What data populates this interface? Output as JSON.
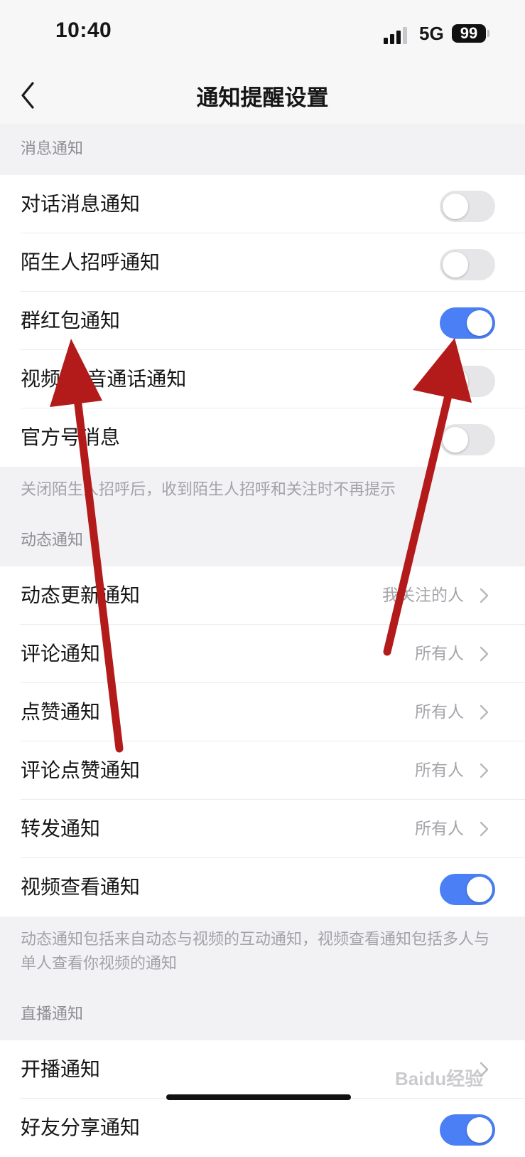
{
  "status_bar": {
    "time": "10:40",
    "network": "5G",
    "battery": "99"
  },
  "header": {
    "title": "通知提醒设置"
  },
  "sections": [
    {
      "header": "消息通知",
      "items": [
        {
          "label": "对话消息通知",
          "control": "toggle",
          "on": false
        },
        {
          "label": "陌生人招呼通知",
          "control": "toggle",
          "on": false
        },
        {
          "label": "群红包通知",
          "control": "toggle",
          "on": true
        },
        {
          "label": "视频/语音通话通知",
          "control": "toggle",
          "on": false
        },
        {
          "label": "官方号消息",
          "control": "toggle",
          "on": false
        }
      ],
      "footnote": "关闭陌生人招呼后，收到陌生人招呼和关注时不再提示"
    },
    {
      "header": "动态通知",
      "items": [
        {
          "label": "动态更新通知",
          "control": "value",
          "value": "我关注的人"
        },
        {
          "label": "评论通知",
          "control": "value",
          "value": "所有人"
        },
        {
          "label": "点赞通知",
          "control": "value",
          "value": "所有人"
        },
        {
          "label": "评论点赞通知",
          "control": "value",
          "value": "所有人"
        },
        {
          "label": "转发通知",
          "control": "value",
          "value": "所有人"
        },
        {
          "label": "视频查看通知",
          "control": "toggle",
          "on": true
        }
      ],
      "footnote": "动态通知包括来自动态与视频的互动通知，视频查看通知包括多人与单人查看你视频的通知"
    },
    {
      "header": "直播通知",
      "items": [
        {
          "label": "开播通知",
          "control": "chevron"
        },
        {
          "label": "好友分享通知",
          "control": "toggle",
          "on": true
        }
      ]
    }
  ],
  "watermark": "Baidu经验",
  "annotation": {
    "color": "#b31b1b"
  },
  "colors": {
    "toggle_on": "#4a7ff5",
    "toggle_off": "#e6e6e8",
    "background": "#f2f2f4"
  }
}
